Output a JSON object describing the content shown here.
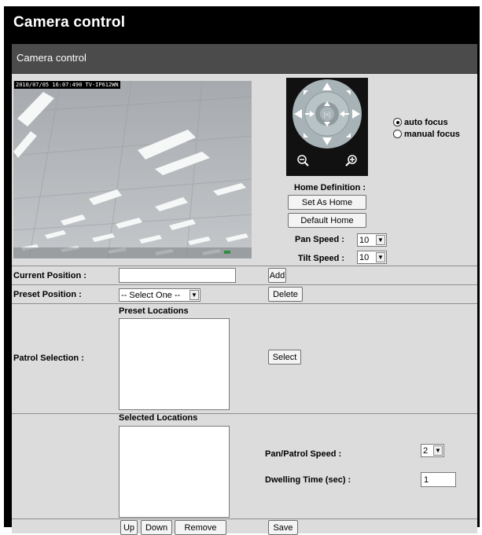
{
  "app_title": "Camera control",
  "section_title": "Camera control",
  "video": {
    "timestamp": "2010/07/05 16:07:490 TV-IP612WN"
  },
  "ptz": {
    "center_label": "[+]",
    "zoom_out_icon": "zoom-out-icon",
    "zoom_in_icon": "zoom-in-icon"
  },
  "focus": {
    "options": [
      {
        "label": "auto focus",
        "checked": true
      },
      {
        "label": "manual focus",
        "checked": false
      }
    ]
  },
  "home": {
    "title": "Home Definition :",
    "set_home": "Set As Home",
    "default_home": "Default Home"
  },
  "speed": {
    "pan_label": "Pan Speed :",
    "pan_value": "10",
    "tilt_label": "Tilt Speed :",
    "tilt_value": "10"
  },
  "current_position": {
    "label": "Current Position :",
    "value": "",
    "add_label": "Add"
  },
  "preset_position": {
    "label": "Preset Position :",
    "select_value": "-- Select One --",
    "delete_label": "Delete"
  },
  "patrol": {
    "label": "Patrol Selection :",
    "preset_locations_title": "Preset Locations",
    "select_label": "Select",
    "selected_locations_title": "Selected Locations",
    "pan_patrol_speed_label": "Pan/Patrol Speed :",
    "pan_patrol_speed_value": "2",
    "dwelling_label": "Dwelling Time (sec) :",
    "dwelling_value": "1"
  },
  "bottom": {
    "up": "Up",
    "down": "Down",
    "remove": "Remove",
    "save": "Save"
  },
  "colors": {
    "panel_bg": "#dcdcdc",
    "header_bar": "#4b4b4b",
    "frame": "#000000"
  }
}
